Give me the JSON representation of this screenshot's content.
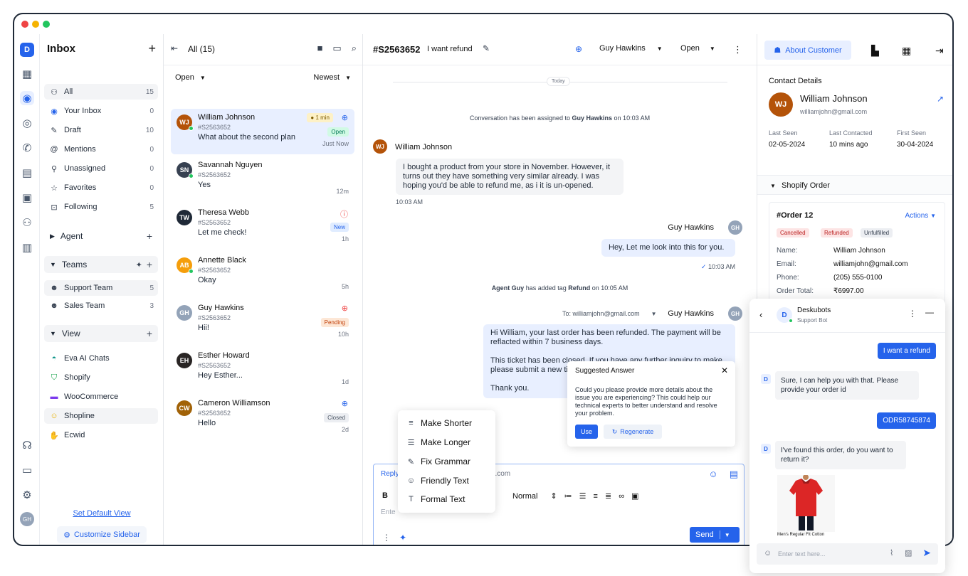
{
  "sidebar": {
    "title": "Inbox",
    "items": [
      {
        "label": "All",
        "count": "15"
      },
      {
        "label": "Your Inbox",
        "count": "0"
      },
      {
        "label": "Draft",
        "count": "10"
      },
      {
        "label": "Mentions",
        "count": "0"
      },
      {
        "label": "Unassigned",
        "count": "0"
      },
      {
        "label": "Favorites",
        "count": "0"
      },
      {
        "label": "Following",
        "count": "5"
      }
    ],
    "agent_label": "Agent",
    "teams_label": "Teams",
    "teams": [
      {
        "label": "Support Team",
        "count": "5"
      },
      {
        "label": "Sales Team",
        "count": "3"
      }
    ],
    "view_label": "View",
    "views": [
      {
        "label": "Eva AI Chats"
      },
      {
        "label": "Shopify"
      },
      {
        "label": "WooCommerce"
      },
      {
        "label": "Shopline"
      },
      {
        "label": "Ecwid"
      }
    ],
    "set_default": "Set Default View",
    "customize": "Customize Sidebar"
  },
  "list": {
    "title": "All (15)",
    "filter": "Open",
    "sort": "Newest",
    "conversations": [
      {
        "name": "William Johnson",
        "id": "#S2563652",
        "msg": "What about the second plan",
        "time": "Just Now",
        "badge": "Open",
        "tag": "1 min",
        "initials": "WJ",
        "color": "#b45309"
      },
      {
        "name": "Savannah Nguyen",
        "id": "#S2563652",
        "msg": "Yes",
        "time": "12m",
        "badge": "",
        "initials": "SN",
        "color": "#374151"
      },
      {
        "name": "Theresa Webb",
        "id": "#S2563652",
        "msg": "Let me check!",
        "time": "1h",
        "badge": "New",
        "initials": "TW",
        "color": "#1f2937"
      },
      {
        "name": "Annette Black",
        "id": "#S2563652",
        "msg": "Okay",
        "time": "5h",
        "badge": "",
        "initials": "AB",
        "color": "#f59e0b"
      },
      {
        "name": "Guy Hawkins",
        "id": "#S2563652",
        "msg": "Hii!",
        "time": "10h",
        "badge": "Pending",
        "initials": "GH",
        "color": "#93a3b8"
      },
      {
        "name": "Esther Howard",
        "id": "#S2563652",
        "msg": "Hey Esther...",
        "time": "1d",
        "badge": "",
        "initials": "EH",
        "color": "#292524"
      },
      {
        "name": "Cameron Williamson",
        "id": "#S2563652",
        "msg": "Hello",
        "time": "2d",
        "badge": "Closed",
        "initials": "CW",
        "color": "#a16207"
      }
    ]
  },
  "chat": {
    "ticket_id": "#S2563652",
    "subject": "I want refund",
    "assignee": "Guy Hawkins",
    "status": "Open",
    "today": "Today",
    "sys1_pre": "Conversation has been assigned to ",
    "sys1_name": "Guy Hawkins",
    "sys1_post": " on 10:03  AM",
    "customer_name": "William Johnson",
    "customer_msg": "I bought a product from your store in November. However, it turns out they have something very similar already. I was hoping you'd be able to refund me, as i it is un-opened.",
    "customer_time": "10:03 AM",
    "agent_name": "Guy Hawkins",
    "agent_msg": "Hey, Let me look into this for you.",
    "agent_time": "10:03  AM",
    "sys2_pre": "Agent Guy",
    "sys2_mid": " has added tag ",
    "sys2_tag": "Refund",
    "sys2_post": " on 10:05 AM",
    "to_line": "To: williamjohn@gmail.com",
    "agent_msg2_p1": "Hi William, your last order has been refunded. The payment will be reflacted within 7 business days.",
    "agent_msg2_p2": "This ticket has been closed. If you have any further inquiry to make, please submit a new ticket.",
    "agent_msg2_p3": "Thank you."
  },
  "reply": {
    "tab": "Reply",
    "to_fragment": "il.com",
    "bold": "B",
    "format": "Normal",
    "placeholder": "Ente",
    "send": "Send"
  },
  "ai_menu": [
    {
      "label": "Make Shorter",
      "icon": "≡"
    },
    {
      "label": "Make Longer",
      "icon": "☰"
    },
    {
      "label": "Fix Grammar",
      "icon": "✎"
    },
    {
      "label": "Friendly Text",
      "icon": "☺"
    },
    {
      "label": "Formal Text",
      "icon": "T"
    }
  ],
  "suggest": {
    "title": "Suggested Answer",
    "text": "Could you please provide more details about the issue you are experiencing? This could help our technical experts to better understand and resolve your problem.",
    "use": "Use",
    "regenerate": "Regenerate"
  },
  "customer": {
    "tab": "About Customer",
    "section": "Contact Details",
    "name": "William Johnson",
    "email": "williamjohn@gmail.com",
    "last_seen_label": "Last Seen",
    "last_seen": "02-05-2024",
    "last_contacted_label": "Last Contacted",
    "last_contacted": "10 mins ago",
    "first_seen_label": "First Seen",
    "first_seen": "30-04-2024",
    "shopify": "Shopify Order",
    "order": {
      "title": "#Order 12",
      "actions": "Actions",
      "tags": [
        "Cancelled",
        "Refunded",
        "Unfulfilled"
      ],
      "name_label": "Name:",
      "name": "William Johnson",
      "email_label": "Email:",
      "email": "williamjohn@gmail.com",
      "phone_label": "Phone:",
      "phone": "(205) 555-0100",
      "total_label": "Order Total:",
      "total": "₹6997.00"
    }
  },
  "widget": {
    "name": "Deskubots",
    "role": "Support Bot",
    "msg1": "I want a refund",
    "msg2": "Sure, I can help you with that. Please provide your order id",
    "msg3": "ODR58745874",
    "msg4": "I've found this order, do you want to return it?",
    "product": "Men's Regular Fit Cotton",
    "placeholder": "Enter text here..."
  }
}
